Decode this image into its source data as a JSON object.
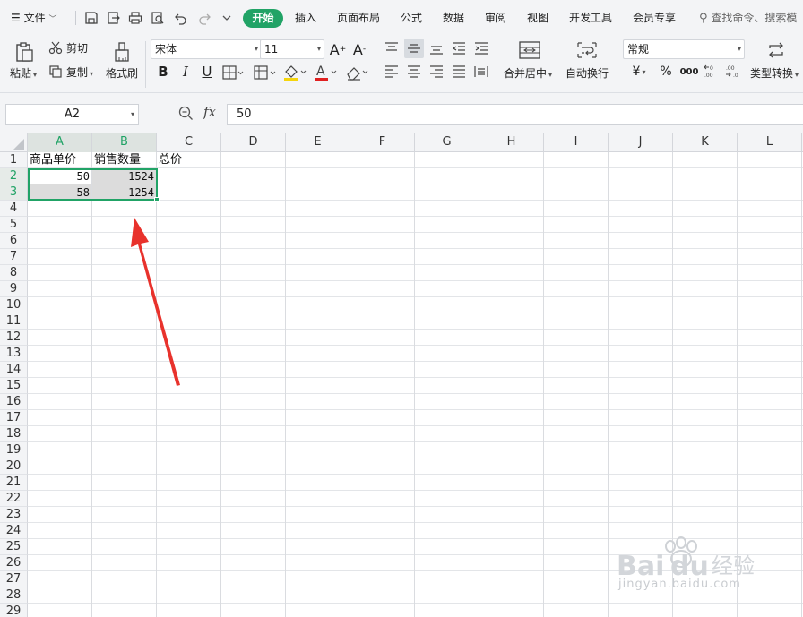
{
  "menu": {
    "file_label": "文件",
    "tabs": [
      "开始",
      "插入",
      "页面布局",
      "公式",
      "数据",
      "审阅",
      "视图",
      "开发工具",
      "会员专享"
    ],
    "search_placeholder": "查找命令、搜索模"
  },
  "ribbon": {
    "paste_label": "粘贴",
    "cut_label": "剪切",
    "copy_label": "复制",
    "format_painter_label": "格式刷",
    "font_name": "宋体",
    "font_size": "11",
    "merge_center_label": "合并居中",
    "wrap_text_label": "自动换行",
    "number_format": "常规",
    "type_convert_label": "类型转换",
    "currency_symbol": "¥",
    "percent_symbol": "%",
    "thousands_symbol": "000"
  },
  "formula_bar": {
    "name_box": "A2",
    "fx_label": "fx",
    "formula": "50"
  },
  "sheet": {
    "columns": [
      "A",
      "B",
      "C",
      "D",
      "E",
      "F",
      "G",
      "H",
      "I",
      "J",
      "K",
      "L"
    ],
    "rows": [
      "1",
      "2",
      "3",
      "4",
      "5",
      "6",
      "7",
      "8",
      "9",
      "10",
      "11",
      "12",
      "13",
      "14",
      "15",
      "16",
      "17",
      "18",
      "19",
      "20",
      "21",
      "22",
      "23",
      "24",
      "25",
      "26",
      "27",
      "28",
      "29"
    ],
    "selected_columns": [
      "A",
      "B"
    ],
    "selected_rows": [
      "2",
      "3"
    ],
    "cells": {
      "A1": "商品单价",
      "B1": "销售数量",
      "C1": "总价",
      "A2": "50",
      "B2": "1524",
      "A3": "58",
      "B3": "1254"
    }
  },
  "watermark": {
    "brand": "Baidu经验",
    "url": "jingyan.baidu.com"
  },
  "colors": {
    "accent": "#21a366",
    "annotation_arrow": "#e8322c"
  }
}
